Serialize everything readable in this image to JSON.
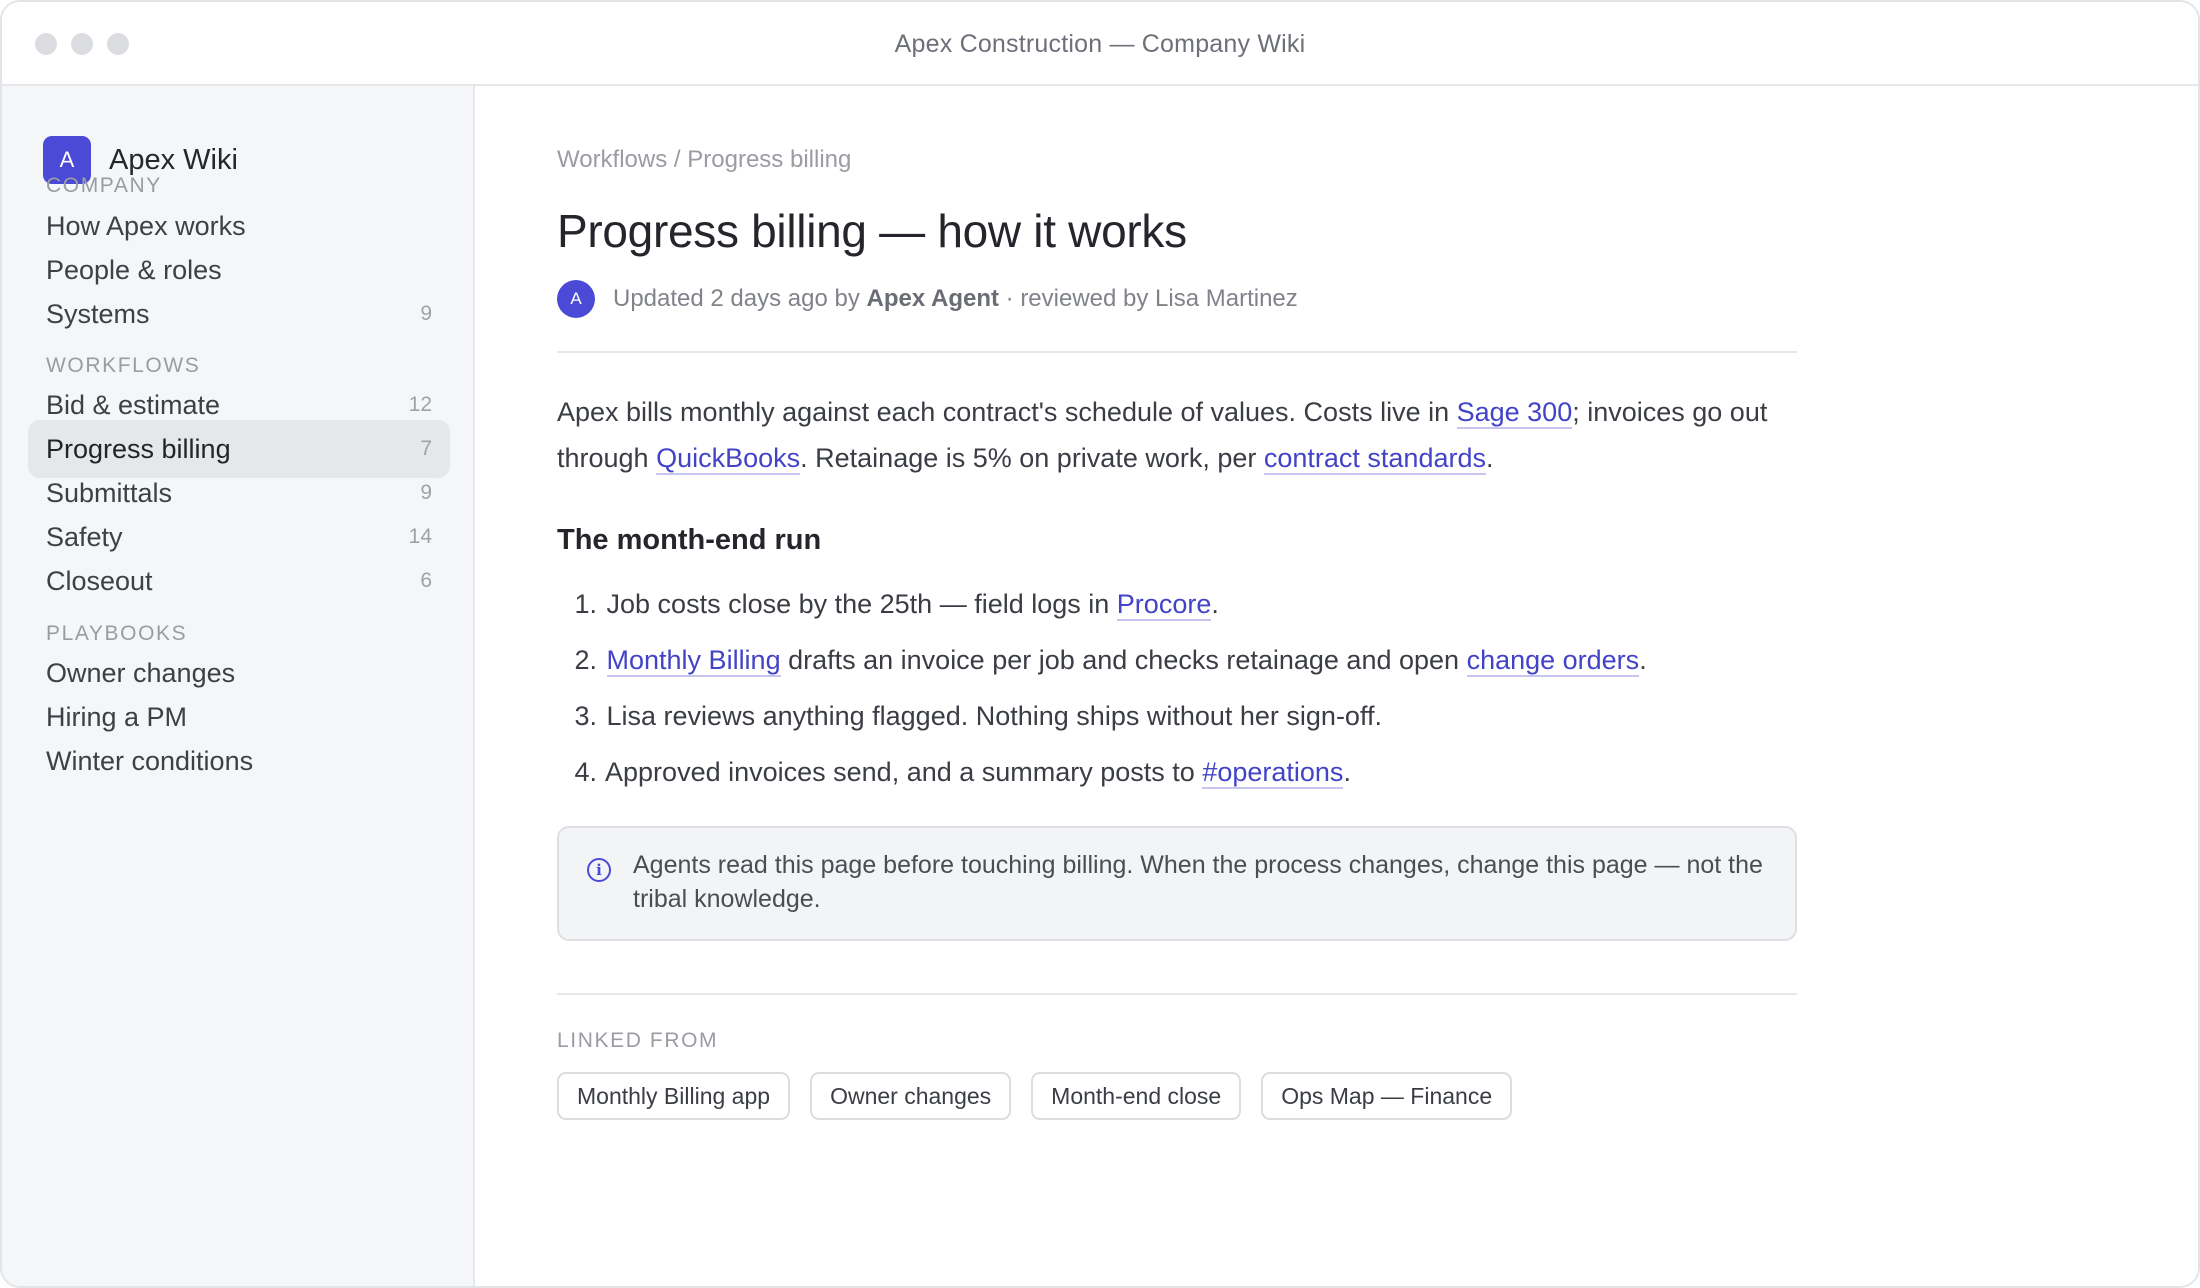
{
  "window": {
    "title": "Apex Construction — Company Wiki"
  },
  "brand": {
    "logo_letter": "A",
    "name": "Apex Wiki",
    "accent": "#4a4ad6"
  },
  "sidebar": {
    "sections": [
      {
        "label": "COMPANY",
        "items": [
          {
            "label": "How Apex works",
            "count": ""
          },
          {
            "label": "People & roles",
            "count": ""
          },
          {
            "label": "Systems",
            "count": "9"
          }
        ]
      },
      {
        "label": "WORKFLOWS",
        "items": [
          {
            "label": "Bid & estimate",
            "count": "12"
          },
          {
            "label": "Progress billing",
            "count": "7",
            "active": true
          },
          {
            "label": "Submittals",
            "count": "9"
          },
          {
            "label": "Safety",
            "count": "14"
          },
          {
            "label": "Closeout",
            "count": "6"
          }
        ]
      },
      {
        "label": "PLAYBOOKS",
        "items": [
          {
            "label": "Owner changes",
            "count": ""
          },
          {
            "label": "Hiring a PM",
            "count": ""
          },
          {
            "label": "Winter conditions",
            "count": ""
          }
        ]
      }
    ]
  },
  "page": {
    "breadcrumb": {
      "parent": "Workflows",
      "separator": " / ",
      "current": "Progress billing"
    },
    "title": "Progress billing — how it works",
    "meta": {
      "avatar_letter": "A",
      "prefix": "Updated 2 days ago by ",
      "author": "Apex Agent",
      "suffix": " · reviewed by Lisa Martinez"
    },
    "intro": {
      "t1": "Apex bills monthly against each contract's schedule of values. Costs live in ",
      "link1": "Sage 300",
      "t2": "; invoices go out through ",
      "link2": "QuickBooks",
      "t3": ". Retainage is 5% on private work, per ",
      "link3": "contract standards",
      "t4": "."
    },
    "section_heading": "The month-end run",
    "steps": [
      {
        "num": "1.",
        "t1": "Job costs close by the 25th — field logs in ",
        "link": "Procore",
        "t2": "."
      },
      {
        "num": "2.",
        "link": "Monthly Billing",
        "t1": " drafts an invoice per job and checks retainage and open ",
        "link2": "change orders",
        "t2": "."
      },
      {
        "num": "3.",
        "t1": "Lisa reviews anything flagged. Nothing ships without her sign-off."
      },
      {
        "num": "4.",
        "t1": "Approved invoices send, and a summary posts to ",
        "link": "#operations",
        "t2": "."
      }
    ],
    "callout": {
      "icon": "info-icon",
      "text": "Agents read this page before touching billing. When the process changes, change this page — not the tribal knowledge."
    },
    "linked_from": {
      "label": "LINKED FROM",
      "chips": [
        "Monthly Billing app",
        "Owner changes",
        "Month-end close",
        "Ops Map — Finance"
      ]
    }
  }
}
